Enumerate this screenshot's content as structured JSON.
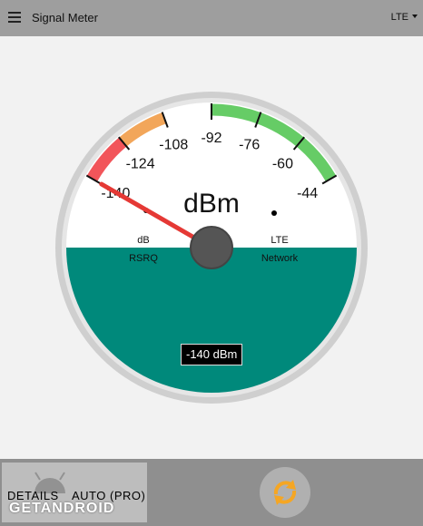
{
  "app": {
    "title": "Signal Meter",
    "network_dropdown": "LTE"
  },
  "gauge": {
    "unit": "dBm",
    "tick_labels": [
      "-140",
      "-124",
      "-108",
      "-92",
      "-76",
      "-60",
      "-44"
    ],
    "tick_values": [
      -140,
      -124,
      -108,
      -92,
      -76,
      -60,
      -44
    ],
    "scale_min": -140,
    "scale_max": -44,
    "needle_value": -140,
    "left_indicator_value": "dB",
    "left_indicator_label": "RSRQ",
    "right_indicator_value": "LTE",
    "right_indicator_label": "Network",
    "reading": "-140 dBm",
    "zones": [
      {
        "from": -140,
        "to": -124,
        "color": "#f2555a"
      },
      {
        "from": -124,
        "to": -108,
        "color": "#f2a65a"
      },
      {
        "from": -92,
        "to": -44,
        "color": "#66cc66"
      }
    ],
    "colors": {
      "face": "#ffffff",
      "lower": "#00897b",
      "rim": "#cfcfcf",
      "needle": "#e53935",
      "hub": "#555555"
    }
  },
  "bottom": {
    "details_label": "DETAILS",
    "auto_label": "AUTO (PRO)",
    "watermark": "GETANDROID",
    "refresh_icon_color": "#f5a623"
  }
}
